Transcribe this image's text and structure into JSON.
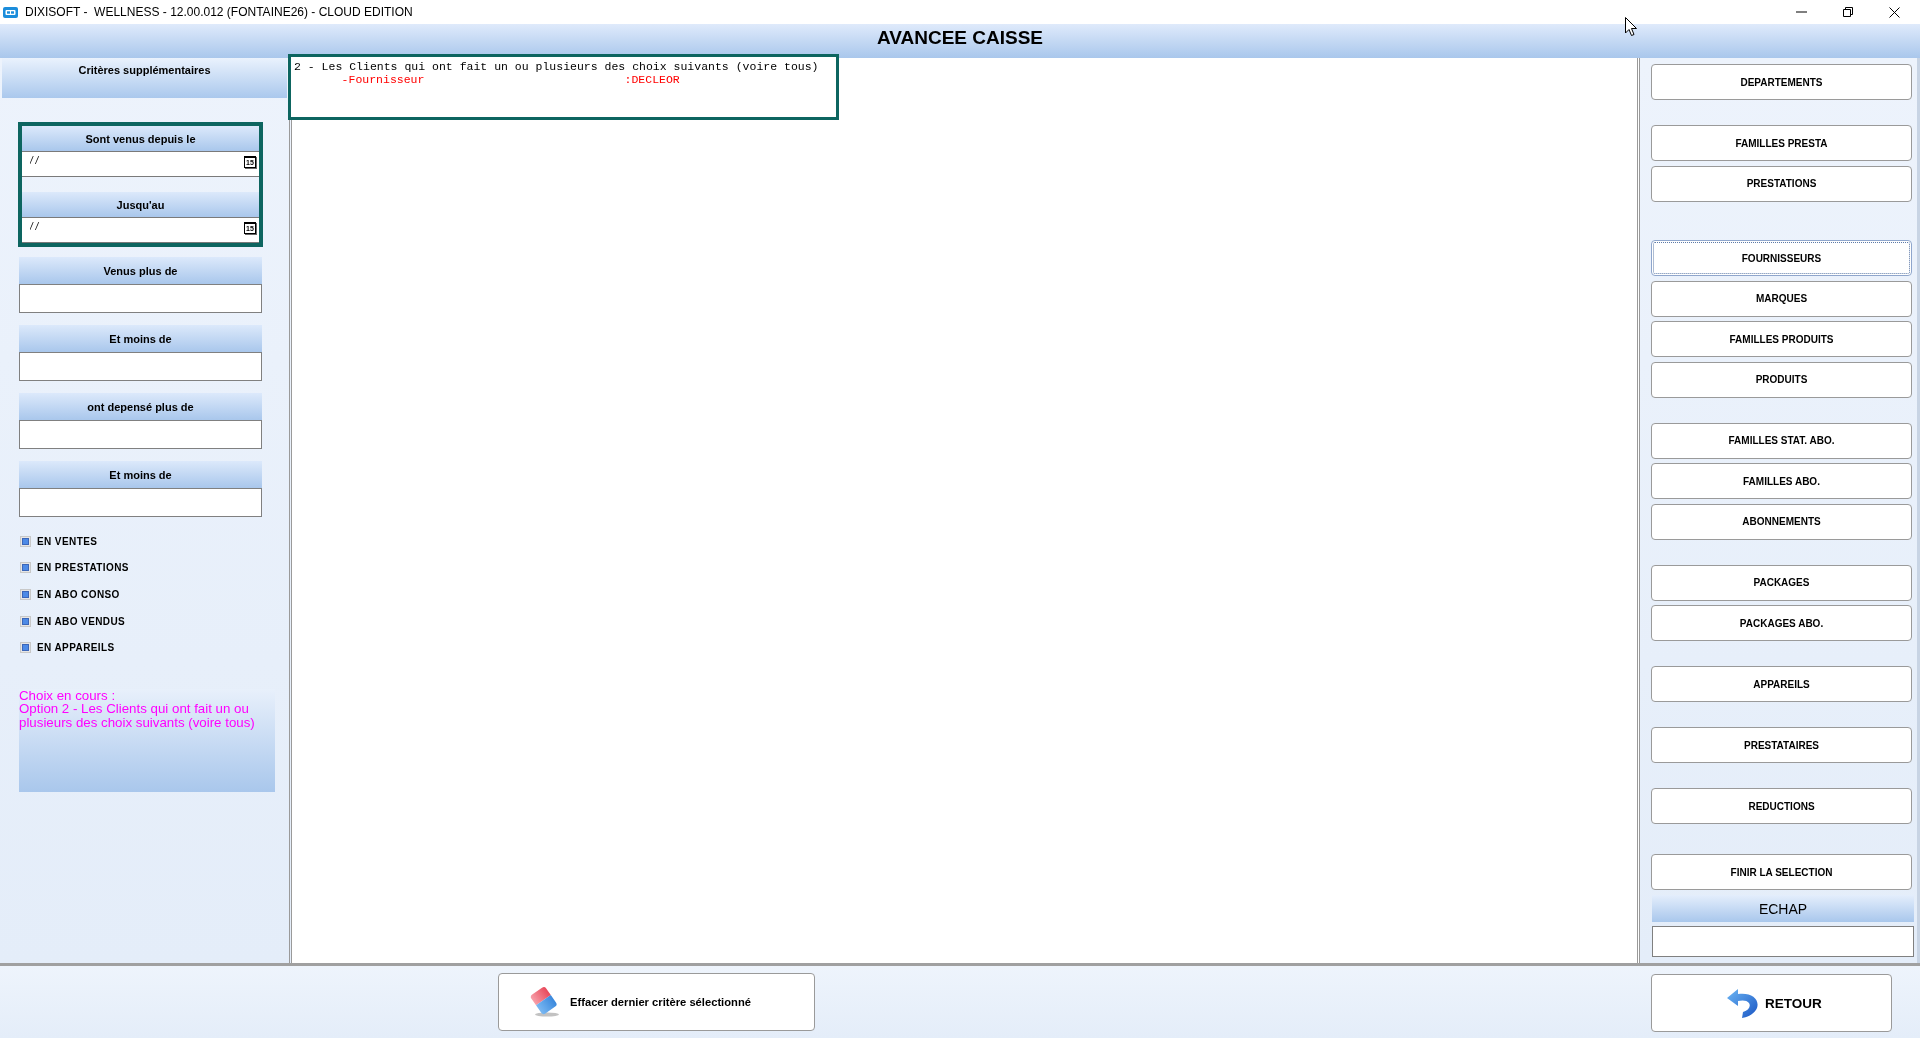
{
  "window": {
    "title": "DIXISOFT -  WELLNESS - 12.00.012 (FONTAINE26) - CLOUD EDITION"
  },
  "header": {
    "title": "AVANCEE CAISSE"
  },
  "criteria_panel": {
    "title": "Critères supplémentaires",
    "date_range": [
      {
        "label": "Sont venus depuis le",
        "value": "/ /",
        "calendar": "15"
      },
      {
        "label": "Jusqu'au",
        "value": "/ /",
        "calendar": "15"
      }
    ],
    "amount_fields": [
      {
        "label": "Venus plus de"
      },
      {
        "label": "Et moins de"
      },
      {
        "label": "ont depensé plus de"
      },
      {
        "label": "Et moins de"
      }
    ],
    "options": [
      {
        "label": "EN VENTES",
        "checked": true
      },
      {
        "label": "EN PRESTATIONS",
        "checked": true
      },
      {
        "label": "EN ABO CONSO",
        "checked": true
      },
      {
        "label": "EN ABO VENDUS",
        "checked": true
      },
      {
        "label": "EN APPAREILS",
        "checked": true
      }
    ],
    "current_choice": {
      "label": "Choix en cours :",
      "text": "Option 2 - Les Clients qui ont fait un ou plusieurs des choix suivants (voire tous)"
    }
  },
  "result_box": {
    "heading": "2 - Les Clients qui ont fait un ou plusieurs des choix suivants (voire tous)",
    "criteria": [
      {
        "label": "-Fournisseur",
        "value": ":DECLEOR"
      }
    ]
  },
  "selection_panel": {
    "button_groups": [
      {
        "buttons": [
          {
            "label": "DEPARTEMENTS",
            "focused": false
          }
        ]
      },
      {
        "buttons": [
          {
            "label": "FAMILLES PRESTA",
            "focused": false
          },
          {
            "label": "PRESTATIONS",
            "focused": false
          }
        ]
      },
      {
        "buttons": [
          {
            "label": "FOURNISSEURS",
            "focused": true
          },
          {
            "label": "MARQUES",
            "focused": false
          },
          {
            "label": "FAMILLES PRODUITS",
            "focused": false
          },
          {
            "label": "PRODUITS",
            "focused": false
          }
        ]
      },
      {
        "buttons": [
          {
            "label": "FAMILLES STAT. ABO.",
            "focused": false
          },
          {
            "label": "FAMILLES ABO.",
            "focused": false
          },
          {
            "label": "ABONNEMENTS",
            "focused": false
          }
        ]
      },
      {
        "buttons": [
          {
            "label": "PACKAGES",
            "focused": false
          },
          {
            "label": "PACKAGES ABO.",
            "focused": false
          }
        ]
      },
      {
        "buttons": [
          {
            "label": "APPAREILS",
            "focused": false
          }
        ]
      },
      {
        "buttons": [
          {
            "label": "PRESTATAIRES",
            "focused": false
          }
        ]
      },
      {
        "buttons": [
          {
            "label": "REDUCTIONS",
            "focused": false
          }
        ]
      },
      {
        "buttons": [
          {
            "label": "FINIR LA SELECTION",
            "focused": false
          }
        ]
      }
    ],
    "escape": {
      "label": "ECHAP"
    }
  },
  "footer": {
    "clear_button": {
      "label": "Effacer dernier critère sélectionné"
    },
    "back_button": {
      "label": "RETOUR"
    }
  }
}
